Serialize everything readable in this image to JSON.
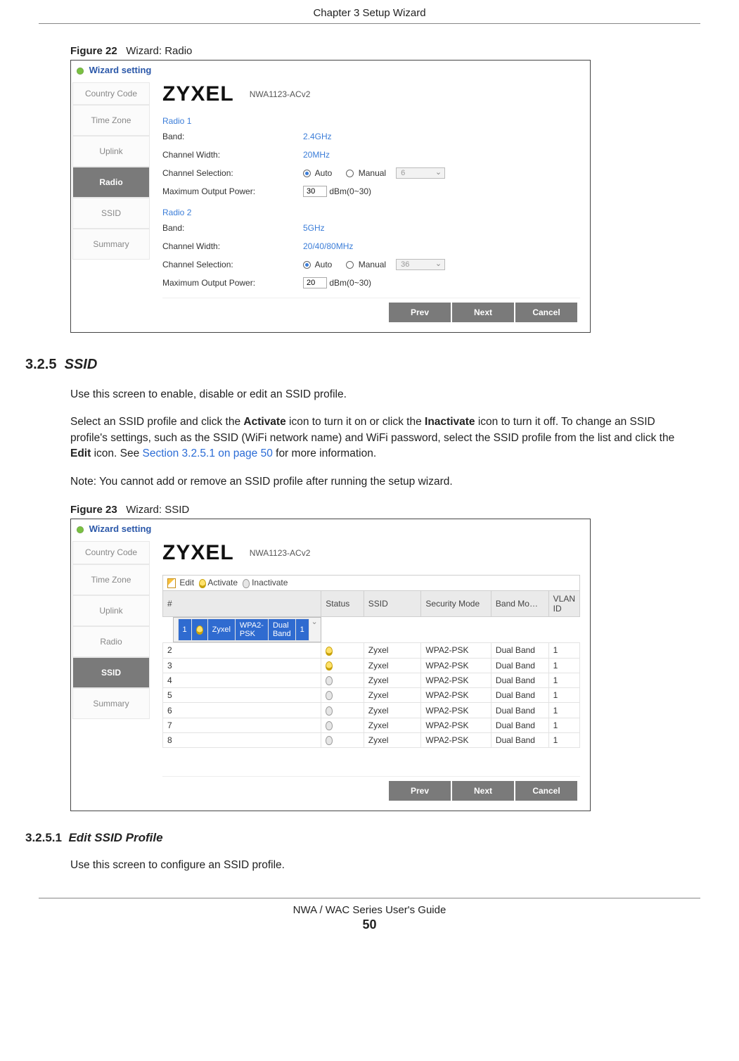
{
  "header": {
    "chapter": "Chapter 3 Setup Wizard"
  },
  "fig22": {
    "caption_label": "Figure 22",
    "caption_text": "Wizard: Radio",
    "window_title": "Wizard setting",
    "steps": {
      "country": "Country Code",
      "tz": "Time Zone",
      "uplink": "Uplink",
      "radio": "Radio",
      "ssid": "SSID",
      "summary": "Summary"
    },
    "brand": "ZYXEL",
    "model": "NWA1123-ACv2",
    "radio1": {
      "title": "Radio 1",
      "band_lbl": "Band:",
      "band_val": "2.4GHz",
      "cw_lbl": "Channel Width:",
      "cw_val": "20MHz",
      "cs_lbl": "Channel Selection:",
      "cs_auto": "Auto",
      "cs_manual": "Manual",
      "cs_dropdown": "6",
      "pwr_lbl": "Maximum Output Power:",
      "pwr_val": "30",
      "pwr_unit": "dBm(0~30)"
    },
    "radio2": {
      "title": "Radio 2",
      "band_lbl": "Band:",
      "band_val": "5GHz",
      "cw_lbl": "Channel Width:",
      "cw_val": "20/40/80MHz",
      "cs_lbl": "Channel Selection:",
      "cs_auto": "Auto",
      "cs_manual": "Manual",
      "cs_dropdown": "36",
      "pwr_lbl": "Maximum Output Power:",
      "pwr_val": "20",
      "pwr_unit": "dBm(0~30)"
    },
    "btn_prev": "Prev",
    "btn_next": "Next",
    "btn_cancel": "Cancel"
  },
  "sec325": {
    "num": "3.2.5",
    "title": "SSID",
    "p1": "Use this screen to enable, disable or edit an SSID profile.",
    "p2a": "Select an SSID profile and click the ",
    "p2b": "Activate",
    "p2c": " icon to turn it on or click the ",
    "p2d": "Inactivate",
    "p2e": " icon to turn it off. To change an SSID profile's settings, such as the SSID (WiFi network name) and WiFi password, select the SSID profile from the list and click the ",
    "p2f": "Edit",
    "p2g": " icon. See ",
    "p2h": "Section 3.2.5.1 on page 50",
    "p2i": " for more information.",
    "note": "Note: You cannot add or remove an SSID profile after running the setup wizard."
  },
  "fig23": {
    "caption_label": "Figure 23",
    "caption_text": "Wizard: SSID",
    "window_title": "Wizard setting",
    "steps": {
      "country": "Country Code",
      "tz": "Time Zone",
      "uplink": "Uplink",
      "radio": "Radio",
      "ssid": "SSID",
      "summary": "Summary"
    },
    "brand": "ZYXEL",
    "model": "NWA1123-ACv2",
    "toolbar": {
      "edit": "Edit",
      "activate": "Activate",
      "inactivate": "Inactivate"
    },
    "cols": {
      "num": "#",
      "status": "Status",
      "ssid": "SSID",
      "sec": "Security Mode",
      "band": "Band Mo…",
      "vlan": "VLAN ID"
    },
    "rows": [
      {
        "n": "1",
        "on": true,
        "ssid": "Zyxel",
        "sec": "WPA2-PSK",
        "band": "Dual Band",
        "vlan": "1",
        "sel": true
      },
      {
        "n": "2",
        "on": true,
        "ssid": "Zyxel",
        "sec": "WPA2-PSK",
        "band": "Dual Band",
        "vlan": "1"
      },
      {
        "n": "3",
        "on": true,
        "ssid": "Zyxel",
        "sec": "WPA2-PSK",
        "band": "Dual Band",
        "vlan": "1"
      },
      {
        "n": "4",
        "on": false,
        "ssid": "Zyxel",
        "sec": "WPA2-PSK",
        "band": "Dual Band",
        "vlan": "1"
      },
      {
        "n": "5",
        "on": false,
        "ssid": "Zyxel",
        "sec": "WPA2-PSK",
        "band": "Dual Band",
        "vlan": "1"
      },
      {
        "n": "6",
        "on": false,
        "ssid": "Zyxel",
        "sec": "WPA2-PSK",
        "band": "Dual Band",
        "vlan": "1"
      },
      {
        "n": "7",
        "on": false,
        "ssid": "Zyxel",
        "sec": "WPA2-PSK",
        "band": "Dual Band",
        "vlan": "1"
      },
      {
        "n": "8",
        "on": false,
        "ssid": "Zyxel",
        "sec": "WPA2-PSK",
        "band": "Dual Band",
        "vlan": "1"
      }
    ],
    "btn_prev": "Prev",
    "btn_next": "Next",
    "btn_cancel": "Cancel"
  },
  "sec3251": {
    "num": "3.2.5.1",
    "title": "Edit SSID Profile",
    "p1": "Use this screen to configure an SSID profile."
  },
  "footer": {
    "guide": "NWA / WAC Series User's Guide",
    "page": "50"
  }
}
